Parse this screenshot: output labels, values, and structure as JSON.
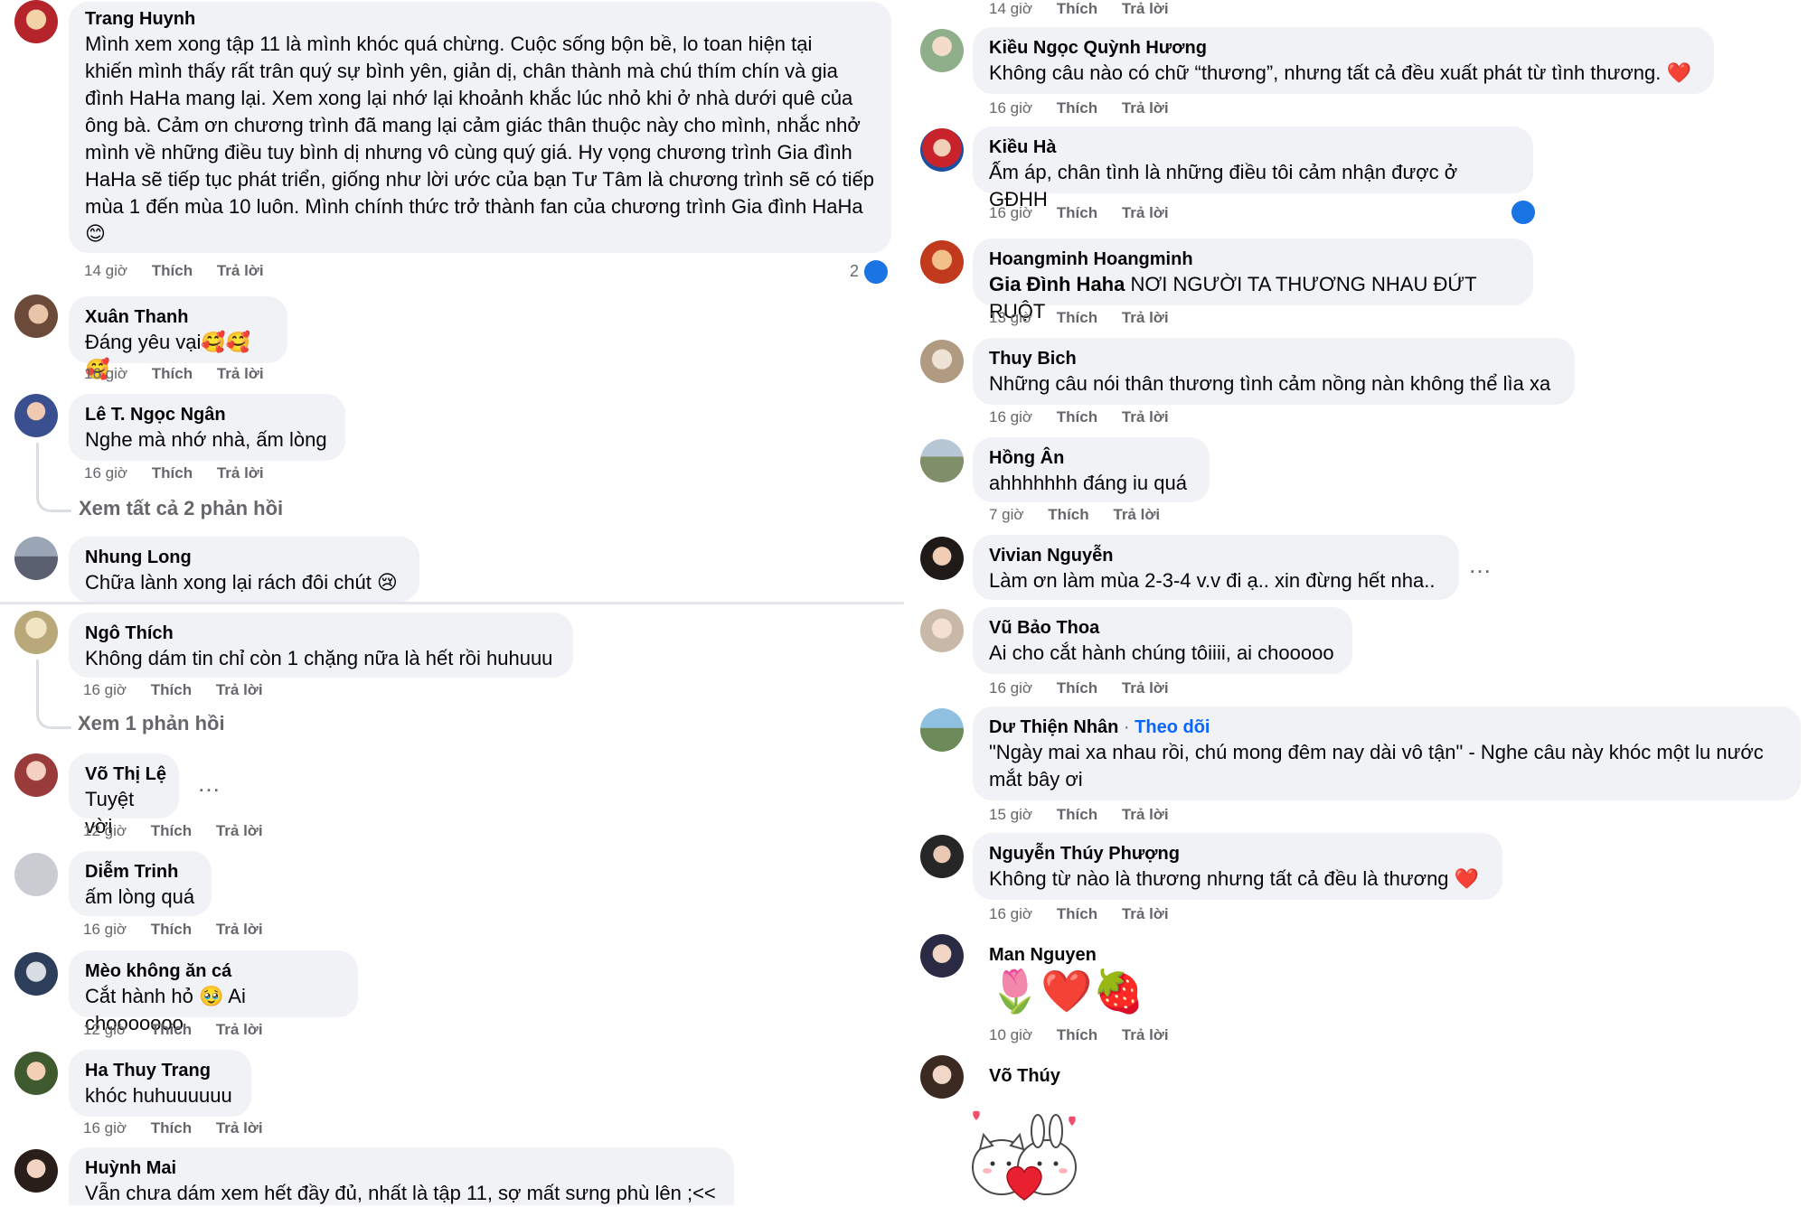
{
  "actions": {
    "like": "Thích",
    "reply": "Trả lời"
  },
  "left": {
    "c1": {
      "name": "Trang Huynh",
      "lines": [
        "Mình xem xong tập 11 là mình khóc quá chừng. Cuộc sống bộn bề, lo toan hiện tại",
        "khiến mình thấy rất trân quý sự bình yên, giản dị, chân thành mà chú thím chín và gia",
        "đình HaHa mang lại. Xem xong lại nhớ lại khoảnh khắc lúc nhỏ khi ở nhà dưới quê của",
        "ông bà. Cảm ơn chương trình đã mang lại cảm giác thân thuộc này cho mình, nhắc nhở",
        "mình về những điều tuy bình dị nhưng vô cùng quý giá. Hy vọng chương trình Gia đình",
        "HaHa sẽ tiếp tục phát triển, giống như lời ước của bạn Tư Tâm là chương trình sẽ có tiếp",
        "mùa 1 đến mùa 10 luôn. Mình chính thức trở thành fan của chương trình Gia đình HaHa",
        "😊"
      ],
      "time": "14 giờ",
      "likes": "2"
    },
    "c2": {
      "name": "Xuân Thanh",
      "text": "Đáng yêu vại🥰🥰🥰",
      "time": "16 giờ"
    },
    "c3": {
      "name": "Lê T. Ngọc Ngân",
      "text": "Nghe mà nhớ nhà, ấm lòng",
      "time": "16 giờ",
      "replies": "Xem tất cả 2 phản hồi"
    },
    "c4": {
      "name": "Nhung Long",
      "text": "Chữa lành xong lại rách đôi chút 😢"
    },
    "c5": {
      "name": "Ngô Thích",
      "text": "Không dám tin chỉ còn 1 chặng nữa là hết rồi huhuuu",
      "time": "16 giờ",
      "replies": "Xem 1 phản hồi"
    },
    "c6": {
      "name": "Võ Thị Lệ",
      "text": "Tuyệt vời",
      "time": "12 giờ"
    },
    "c7": {
      "name": "Diễm Trinh",
      "text": "ấm lòng quá",
      "time": "16 giờ"
    },
    "c8": {
      "name": "Mèo không ăn cá",
      "text": "Cắt hành hỏ 🥹 Ai chooooooo",
      "time": "12 giờ"
    },
    "c9": {
      "name": "Ha Thuy Trang",
      "text": "khóc huhuuuuuu",
      "time": "16 giờ"
    },
    "c10": {
      "name": "Huỳnh Mai",
      "text": "Vẫn chưa dám xem hết đầy đủ, nhất là tập 11, sợ mất sưng phù lên ;<<"
    }
  },
  "right": {
    "top_time": "14 giờ",
    "r1": {
      "name": "Kiều Ngọc Quỳnh Hương",
      "text": "Không câu nào có chữ “thương”, nhưng tất cả đều xuất phát từ tình thương. ❤️",
      "time": "16 giờ"
    },
    "r2": {
      "name": "Kiều Hà",
      "text": "Ấm áp, chân tình là những điều tôi cảm nhận được ở GĐHH",
      "time": "16 giờ"
    },
    "r3": {
      "name": "Hoangminh Hoangminh",
      "tag": "Gia Đình Haha",
      "text": " NƠI NGƯỜI TA THƯƠNG NHAU ĐỨT RUỘT",
      "time": "13 giờ"
    },
    "r4": {
      "name": "Thuy Bich",
      "text": "Những câu nói thân thương tình cảm nồng nàn không thể lìa xa",
      "time": "16 giờ"
    },
    "r5": {
      "name": "Hồng Ân",
      "text": "ahhhhhhh đáng iu quá",
      "time": "7 giờ"
    },
    "r6": {
      "name": "Vivian Nguyễn",
      "text": "Làm ơn làm mùa 2-3-4 v.v đi ạ.. xin đừng hết nha.."
    },
    "r7": {
      "name": "Vũ Bảo Thoa",
      "text": "Ai cho cắt hành chúng tôiiii, ai chooooo",
      "time": "16 giờ"
    },
    "r8": {
      "name": "Dư Thiện Nhân",
      "follow": "Theo dõi",
      "sep": " · ",
      "lines": [
        "\"Ngày mai xa nhau rồi, chú mong đêm nay dài vô tận\" - Nghe câu này khóc một lu nước",
        "mắt bây ơi"
      ],
      "time": "15 giờ"
    },
    "r9": {
      "name": "Nguyễn Thúy Phượng",
      "text": "Không từ nào là thương nhưng tất cả đều là thương ❤️",
      "time": "16 giờ"
    },
    "r10": {
      "name": "Man Nguyen",
      "emojis": "🌷❤️🍓",
      "time": "10 giờ"
    },
    "r11": {
      "name": "Võ Thúy"
    }
  },
  "colors": {
    "bubble": "#f0f2f5",
    "meta": "#65676b",
    "follow": "#0866ff",
    "like_blue": "#1b74e4"
  }
}
